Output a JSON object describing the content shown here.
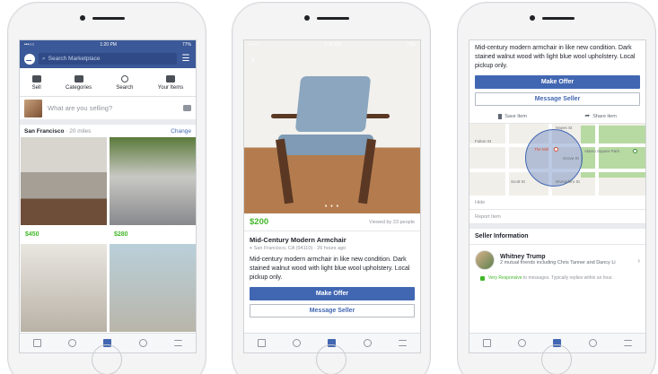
{
  "phone1": {
    "status": {
      "time": "1:20 PM",
      "carrier": "•••○○",
      "battery": "77%"
    },
    "search_placeholder": "Search Marketplace",
    "tabs": [
      {
        "label": "Sell"
      },
      {
        "label": "Categories"
      },
      {
        "label": "Search"
      },
      {
        "label": "Your Items"
      }
    ],
    "compose_placeholder": "What are you selling?",
    "location": {
      "city": "San Francisco",
      "distance": " · 20 miles",
      "change": "Change"
    },
    "items": [
      {
        "price": "$450",
        "label": "sofa"
      },
      {
        "price": "$280",
        "label": "bike"
      },
      {
        "price": "",
        "label": "coffee"
      },
      {
        "price": "",
        "label": "table"
      }
    ]
  },
  "phone2": {
    "status": {
      "time": "1:20 PM",
      "carrier": "•••○○",
      "battery": "77%"
    },
    "back": "‹",
    "dots": "• • •",
    "price": "$200",
    "viewed": "Viewed by 23 people",
    "title": "Mid-Century Modern Armchair",
    "meta": "San Francisco, CA (94110) · 26 hours ago",
    "description": "Mid-century modern armchair in like new condition. Dark stained walnut wood with light blue wool upholstery. Local pickup only.",
    "make_offer": "Make Offer",
    "message_seller": "Message Seller"
  },
  "phone3": {
    "description": "Mid-century modern armchair in like new condition. Dark stained walnut wood with light blue wool upholstery. Local pickup only.",
    "make_offer": "Make Offer",
    "message_seller": "Message Seller",
    "save_item": "Save Item",
    "share_item": "Share item",
    "map_labels": [
      "Fulton St",
      "The Mill",
      "Grove St",
      "Alamo Square Park",
      "Divisadero St",
      "Scott St",
      "Hayes St"
    ],
    "hide": "Hide",
    "report": "Report Item",
    "seller_heading": "Seller Information",
    "seller_name": "Whitney Trump",
    "mutual": "2 mutual friends including Chris Tanner and Dancy Li",
    "responsive_label": "Very Responsive",
    "responsive_text": " to messages. Typically replies within an hour."
  },
  "colors": {
    "brand": "#3b5998",
    "accent": "#4267b2",
    "price": "#42b72a"
  }
}
